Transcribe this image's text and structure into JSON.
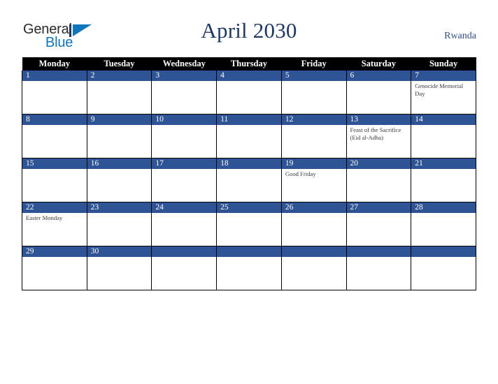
{
  "brand": {
    "name_part1": "General",
    "name_part2": "Blue",
    "triangle_color": "#1175bb"
  },
  "header": {
    "title": "April 2030",
    "country": "Rwanda"
  },
  "calendar": {
    "weekday_headers": [
      "Monday",
      "Tuesday",
      "Wednesday",
      "Thursday",
      "Friday",
      "Saturday",
      "Sunday"
    ],
    "accent_color": "#2f5496",
    "header_bg": "#000000",
    "weeks": [
      [
        {
          "day": "1",
          "events": []
        },
        {
          "day": "2",
          "events": []
        },
        {
          "day": "3",
          "events": []
        },
        {
          "day": "4",
          "events": []
        },
        {
          "day": "5",
          "events": []
        },
        {
          "day": "6",
          "events": []
        },
        {
          "day": "7",
          "events": [
            "Genocide Memorial Day"
          ]
        }
      ],
      [
        {
          "day": "8",
          "events": []
        },
        {
          "day": "9",
          "events": []
        },
        {
          "day": "10",
          "events": []
        },
        {
          "day": "11",
          "events": []
        },
        {
          "day": "12",
          "events": []
        },
        {
          "day": "13",
          "events": [
            "Feast of the Sacrifice (Eid al-Adha)"
          ]
        },
        {
          "day": "14",
          "events": []
        }
      ],
      [
        {
          "day": "15",
          "events": []
        },
        {
          "day": "16",
          "events": []
        },
        {
          "day": "17",
          "events": []
        },
        {
          "day": "18",
          "events": []
        },
        {
          "day": "19",
          "events": [
            "Good Friday"
          ]
        },
        {
          "day": "20",
          "events": []
        },
        {
          "day": "21",
          "events": []
        }
      ],
      [
        {
          "day": "22",
          "events": [
            "Easter Monday"
          ]
        },
        {
          "day": "23",
          "events": []
        },
        {
          "day": "24",
          "events": []
        },
        {
          "day": "25",
          "events": []
        },
        {
          "day": "26",
          "events": []
        },
        {
          "day": "27",
          "events": []
        },
        {
          "day": "28",
          "events": []
        }
      ],
      [
        {
          "day": "29",
          "events": []
        },
        {
          "day": "30",
          "events": []
        },
        {
          "day": "",
          "events": []
        },
        {
          "day": "",
          "events": []
        },
        {
          "day": "",
          "events": []
        },
        {
          "day": "",
          "events": []
        },
        {
          "day": "",
          "events": []
        }
      ]
    ]
  }
}
